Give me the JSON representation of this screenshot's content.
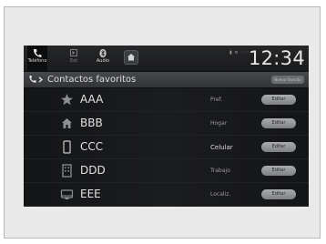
{
  "statusbar": {
    "tabs": [
      {
        "label": "Teléfono",
        "icon": "phone-icon",
        "active": true
      },
      {
        "label": "Ext",
        "icon": "compass-icon",
        "active": false
      },
      {
        "label": "Audio",
        "icon": "bluetooth-icon",
        "active": false
      }
    ],
    "home_icon": "home-icon",
    "status_text": "▮ ≡ ◦◦◦",
    "clock": "12:34"
  },
  "header": {
    "title": "Contactos favoritos",
    "right_button": "Nuevo favorito"
  },
  "contacts": [
    {
      "name": "AAA",
      "type": "Pref.",
      "icon": "star-icon",
      "edit": "Editar"
    },
    {
      "name": "BBB",
      "type": "Hogar",
      "icon": "home-icon",
      "edit": "Editar"
    },
    {
      "name": "CCC",
      "type": "Celular",
      "icon": "mobile-phone-icon",
      "edit": "Editar"
    },
    {
      "name": "DDD",
      "type": "Trabajo",
      "icon": "building-icon",
      "edit": "Editar"
    },
    {
      "name": "EEE",
      "type": "Localiz.",
      "icon": "car-icon",
      "edit": "Editar"
    }
  ],
  "colors": {
    "screen_bg": "#0f1012",
    "header_bg": "#3c3e41",
    "edit_button": "#9a9c9f",
    "text": "#e3e3e3"
  }
}
